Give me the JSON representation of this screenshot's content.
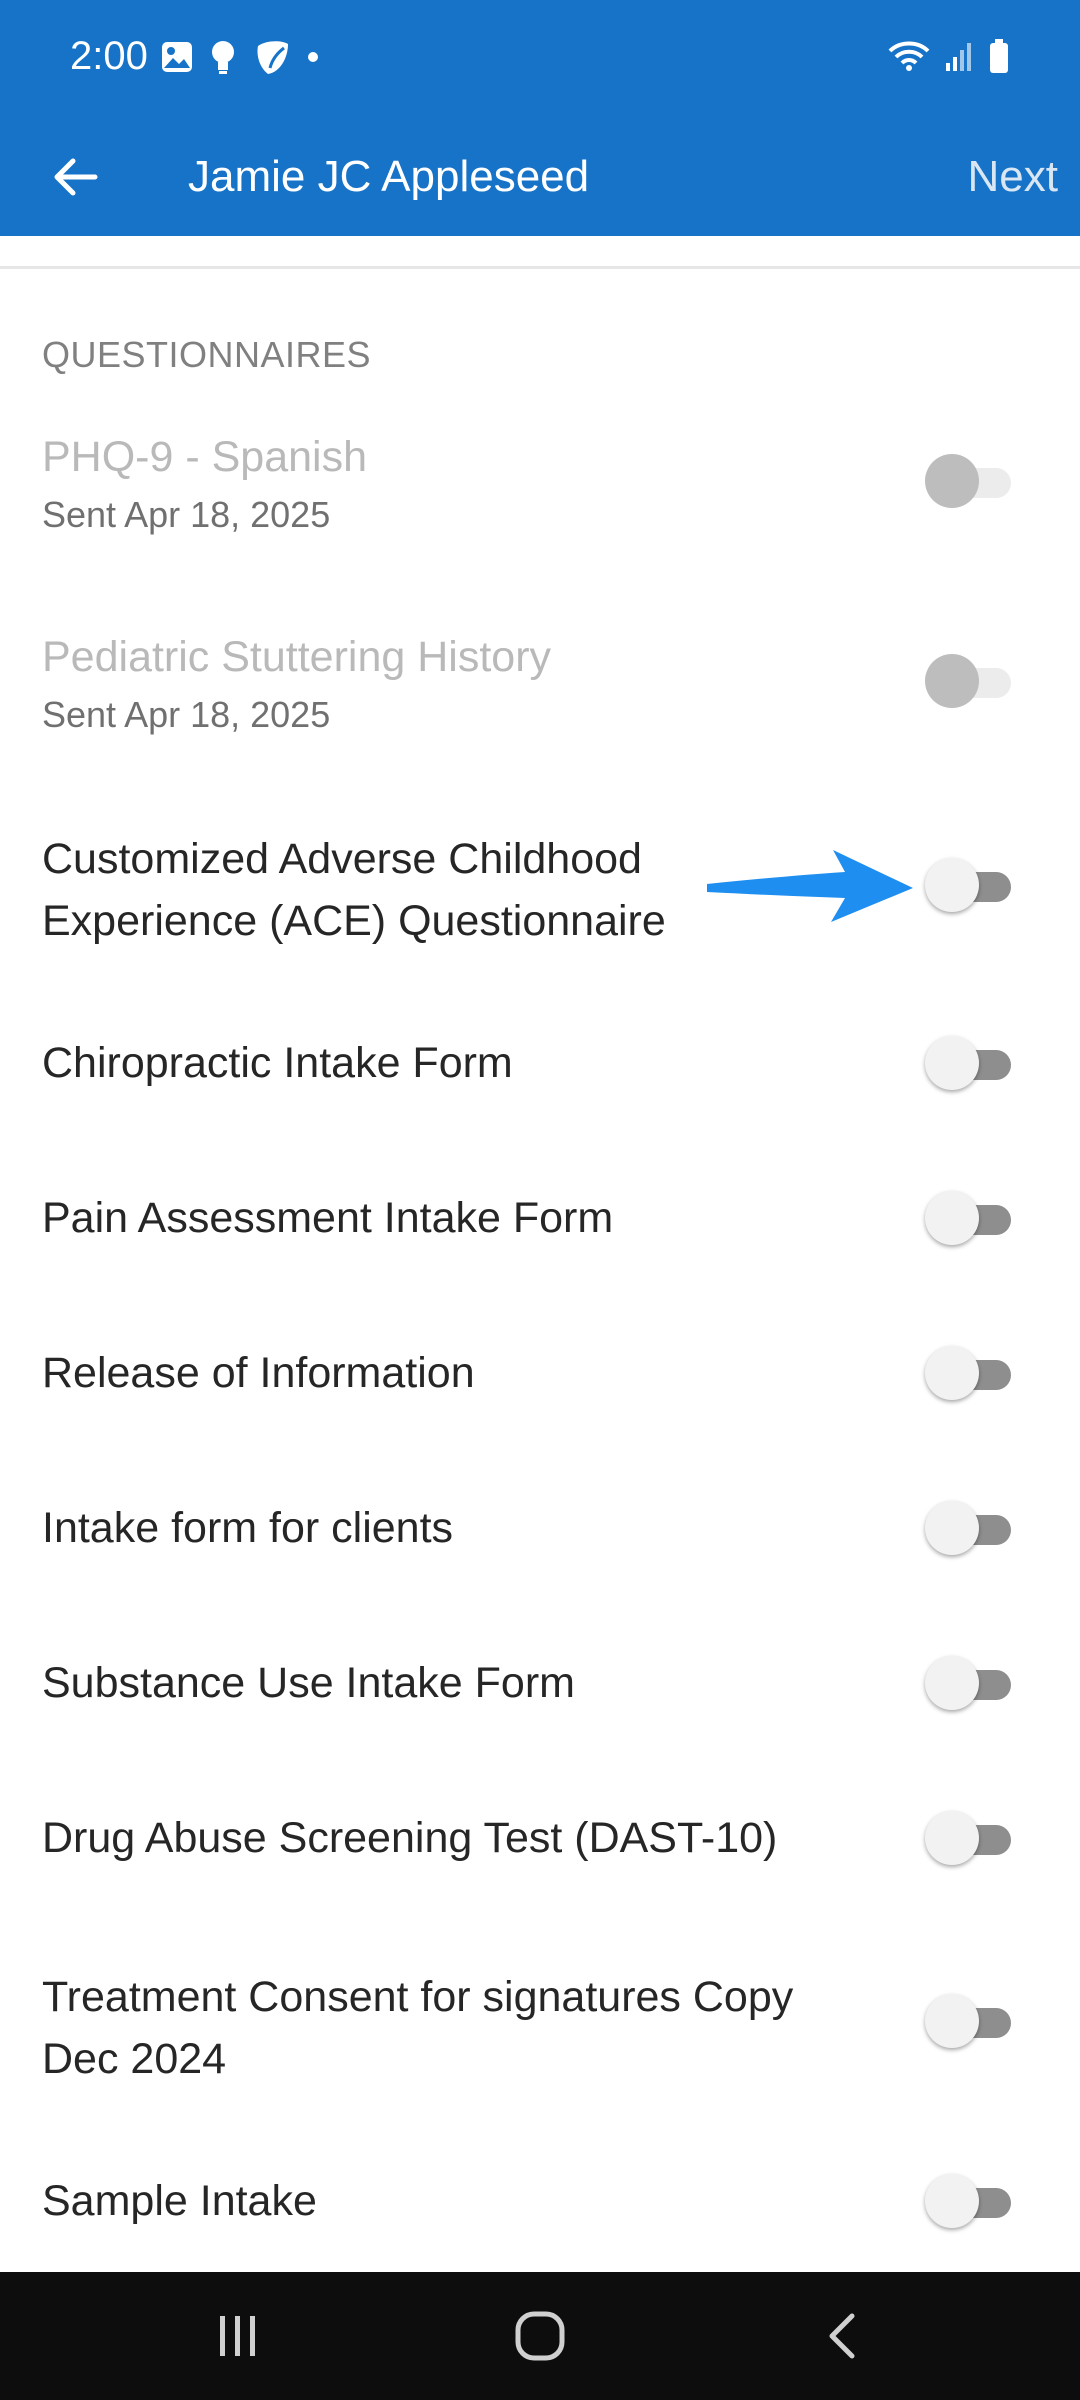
{
  "status_bar": {
    "time": "2:00",
    "left_icons": [
      "gallery-icon",
      "bulb-icon",
      "app-icon",
      "dot-icon"
    ],
    "right_icons": [
      "wifi-icon",
      "signal-icon",
      "battery-icon"
    ]
  },
  "app_bar": {
    "back_icon": "arrow-left-icon",
    "title": "Jamie JC Appleseed",
    "next_label": "Next"
  },
  "section": {
    "header": "QUESTIONNAIRES"
  },
  "items": [
    {
      "title": "PHQ-9 - Spanish",
      "subtitle": "Sent Apr 18, 2025",
      "enabled": false,
      "checked": false
    },
    {
      "title": "Pediatric Stuttering History",
      "subtitle": "Sent Apr 18, 2025",
      "enabled": false,
      "checked": false
    },
    {
      "title": "Customized Adverse Childhood Experience (ACE) Questionnaire",
      "subtitle": "",
      "enabled": true,
      "checked": false
    },
    {
      "title": "Chiropractic Intake Form",
      "subtitle": "",
      "enabled": true,
      "checked": false
    },
    {
      "title": "Pain Assessment Intake Form",
      "subtitle": "",
      "enabled": true,
      "checked": false
    },
    {
      "title": "Release of Information",
      "subtitle": "",
      "enabled": true,
      "checked": false
    },
    {
      "title": "Intake form for clients",
      "subtitle": "",
      "enabled": true,
      "checked": false
    },
    {
      "title": "Substance Use Intake Form",
      "subtitle": "",
      "enabled": true,
      "checked": false
    },
    {
      "title": "Drug Abuse Screening Test (DAST-10)",
      "subtitle": "",
      "enabled": true,
      "checked": false
    },
    {
      "title": "Treatment Consent for signatures Copy Dec 2024",
      "subtitle": "",
      "enabled": true,
      "checked": false
    },
    {
      "title": "Sample Intake",
      "subtitle": "",
      "enabled": true,
      "checked": false
    }
  ],
  "annotation": {
    "icon": "pointer-arrow-icon",
    "color": "#1e8ef0"
  },
  "nav_bar": {
    "icons": [
      "recents-icon",
      "home-icon",
      "back-icon"
    ]
  },
  "colors": {
    "primary": "#1673c8",
    "annotation_arrow": "#1e8ef0"
  }
}
